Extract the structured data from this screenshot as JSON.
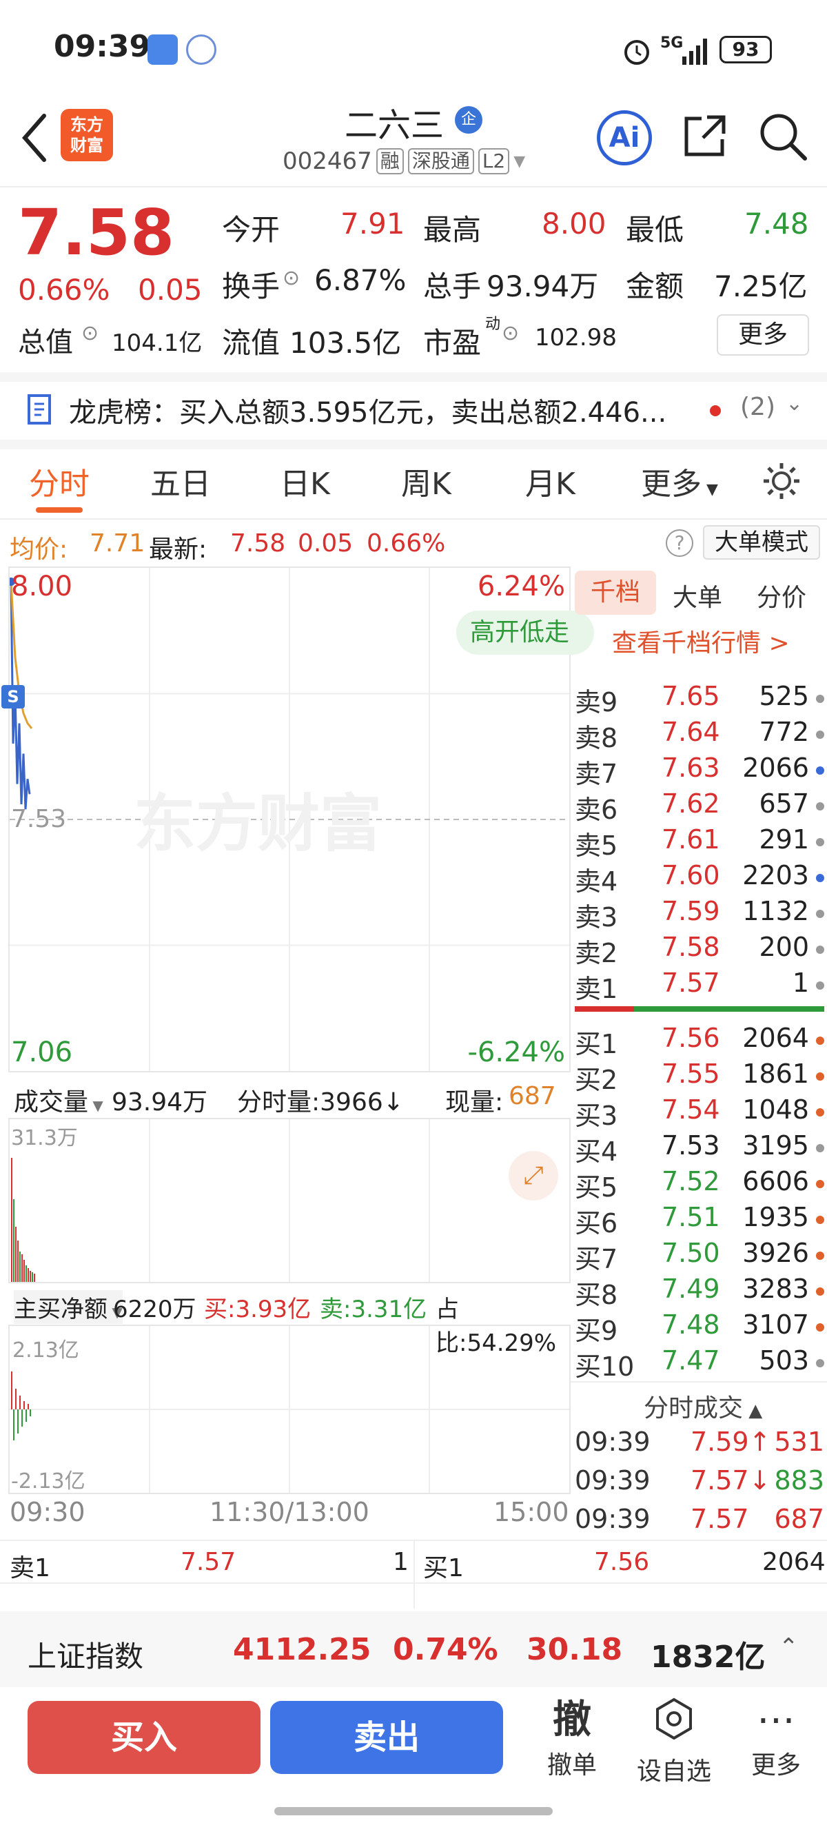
{
  "status_bar": {
    "time": "09:39",
    "network": "5G",
    "battery": "93"
  },
  "header": {
    "logo_line1": "东方",
    "logo_line2": "财富",
    "stock_name": "二六三",
    "badge": "企",
    "code": "002467",
    "tags": [
      "融",
      "深股通",
      "L2"
    ]
  },
  "quote": {
    "price": "7.58",
    "change_pct": "0.66%",
    "change": "0.05",
    "open_label": "今开",
    "open": "7.91",
    "high_label": "最高",
    "high": "8.00",
    "low_label": "最低",
    "low": "7.48",
    "turnover_label": "换手",
    "turnover": "6.87%",
    "volume_label": "总手",
    "volume": "93.94万",
    "amount_label": "金额",
    "amount": "7.25亿",
    "mktcap_label": "总值",
    "mktcap": "104.1亿",
    "float_label": "流值",
    "float_cap": "103.5亿",
    "pe_label": "市盈",
    "pe_sup": "动",
    "pe": "102.98",
    "more": "更多"
  },
  "lhb": {
    "text": "龙虎榜：买入总额3.595亿元，卖出总额2.446...",
    "count": "(2)"
  },
  "tabs": [
    "分时",
    "五日",
    "日K",
    "周K",
    "月K",
    "更多"
  ],
  "info_row": {
    "avg_label": "均价:",
    "avg": "7.71",
    "latest_label": "最新:",
    "latest": "7.58",
    "change": "0.05",
    "pct": "0.66%",
    "mode_button": "大单模式"
  },
  "chart": {
    "top_price": "8.00",
    "top_pct": "6.24%",
    "mid_price": "7.53",
    "bottom_price": "7.06",
    "bottom_pct": "-6.24%",
    "tag": "高开低走",
    "watermark": "东方财富",
    "s_marker": "S",
    "vol_label": "成交量",
    "vol_total": "93.94万",
    "vol_tick": "分时量:3966↓",
    "vol_now_label": "现量:",
    "vol_now": "687",
    "vol_max": "31.3万",
    "flow_label": "主买净额",
    "flow_total": "6220万",
    "flow_buy": "买:3.93亿",
    "flow_sell": "卖:3.31亿",
    "flow_ratio": "占比:54.29%",
    "flow_max": "2.13亿",
    "flow_min": "-2.13亿",
    "time_start": "09:30",
    "time_mid": "11:30/13:00",
    "time_end": "15:00",
    "price_range": [
      7.06,
      8.0
    ],
    "prices": [
      8.0,
      7.68,
      7.78,
      7.6,
      7.72,
      7.56,
      7.66,
      7.55,
      7.61,
      7.58
    ],
    "avg_prices": [
      8.0,
      7.85,
      7.78,
      7.74,
      7.72,
      7.71
    ],
    "volumes": [
      0.9,
      0.6,
      0.4,
      0.3,
      0.22,
      0.2,
      0.16,
      0.12,
      0.1,
      0.08,
      0.07,
      0.06
    ],
    "flows": [
      0.55,
      -0.45,
      0.3,
      -0.35,
      0.2,
      -0.25,
      0.12,
      -0.18,
      0.08,
      -0.1
    ]
  },
  "orderbook": {
    "tabs": [
      "千档",
      "大单",
      "分价"
    ],
    "view_more": "查看千档行情 >",
    "sells": [
      {
        "label": "卖9",
        "price": "7.65",
        "vol": "525",
        "dot": "#999999"
      },
      {
        "label": "卖8",
        "price": "7.64",
        "vol": "772",
        "dot": "#999999"
      },
      {
        "label": "卖7",
        "price": "7.63",
        "vol": "2066",
        "dot": "#3a6ad8"
      },
      {
        "label": "卖6",
        "price": "7.62",
        "vol": "657",
        "dot": "#999999"
      },
      {
        "label": "卖5",
        "price": "7.61",
        "vol": "291",
        "dot": "#999999"
      },
      {
        "label": "卖4",
        "price": "7.60",
        "vol": "2203",
        "dot": "#3a6ad8"
      },
      {
        "label": "卖3",
        "price": "7.59",
        "vol": "1132",
        "dot": "#999999"
      },
      {
        "label": "卖2",
        "price": "7.58",
        "vol": "200",
        "dot": "#999999"
      },
      {
        "label": "卖1",
        "price": "7.57",
        "vol": "1",
        "dot": "#999999"
      }
    ],
    "buys": [
      {
        "label": "买1",
        "price": "7.56",
        "vol": "2064",
        "dot": "#e0622a",
        "color": "red"
      },
      {
        "label": "买2",
        "price": "7.55",
        "vol": "1861",
        "dot": "#e0622a",
        "color": "red"
      },
      {
        "label": "买3",
        "price": "7.54",
        "vol": "1048",
        "dot": "#e0622a",
        "color": "red"
      },
      {
        "label": "买4",
        "price": "7.53",
        "vol": "3195",
        "dot": "#999999",
        "color": "dark"
      },
      {
        "label": "买5",
        "price": "7.52",
        "vol": "6606",
        "dot": "#e0622a",
        "color": "green"
      },
      {
        "label": "买6",
        "price": "7.51",
        "vol": "1935",
        "dot": "#e0622a",
        "color": "green"
      },
      {
        "label": "买7",
        "price": "7.50",
        "vol": "3926",
        "dot": "#e0622a",
        "color": "green"
      },
      {
        "label": "买8",
        "price": "7.49",
        "vol": "3283",
        "dot": "#e0622a",
        "color": "green"
      },
      {
        "label": "买9",
        "price": "7.48",
        "vol": "3107",
        "dot": "#e0622a",
        "color": "green"
      },
      {
        "label": "买10",
        "price": "7.47",
        "vol": "503",
        "dot": "#999999",
        "color": "green"
      }
    ],
    "ticks_title": "分时成交",
    "ticks": [
      {
        "time": "09:39",
        "price": "7.59↑",
        "vol": "531",
        "pc": "red",
        "vc": "red"
      },
      {
        "time": "09:39",
        "price": "7.57↓",
        "vol": "883",
        "pc": "red",
        "vc": "green"
      },
      {
        "time": "09:39",
        "price": "7.57",
        "vol": "687",
        "pc": "red",
        "vc": "red"
      }
    ]
  },
  "bottom_quote": {
    "sell_label": "卖1",
    "sell_price": "7.57",
    "sell_vol": "1",
    "buy_label": "买1",
    "buy_price": "7.56",
    "buy_vol": "2064"
  },
  "index_bar": {
    "name": "上证指数",
    "value": "4112.25",
    "pct": "0.74%",
    "change": "30.18",
    "amount": "1832亿"
  },
  "actions": {
    "buy": "买入",
    "sell": "卖出",
    "cancel_icon": "撤",
    "cancel": "撤单",
    "watch": "设自选",
    "more": "更多"
  }
}
